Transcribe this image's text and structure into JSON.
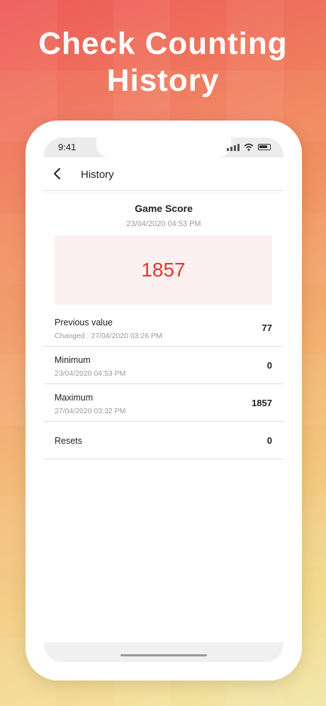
{
  "headline": {
    "line1": "Check Counting",
    "line2": "History"
  },
  "status_bar": {
    "time": "9:41",
    "icons": [
      "signal-icon",
      "wifi-icon",
      "battery-icon"
    ]
  },
  "app_bar": {
    "title": "History",
    "back_icon": "chevron-left-icon"
  },
  "counter": {
    "name": "Game Score",
    "date": "23/04/2020 04:53 PM",
    "value": "1857",
    "value_color": "#e8342f",
    "box_color": "#fdf0f0"
  },
  "stats": [
    {
      "label": "Previous value",
      "sub": "Changed : 27/04/2020 03:26 PM",
      "value": "77"
    },
    {
      "label": "Minimum",
      "sub": "23/04/2020 04:53 PM",
      "value": "0"
    },
    {
      "label": "Maximum",
      "sub": "27/04/2020 03:32 PM",
      "value": "1857"
    },
    {
      "label": "Resets",
      "sub": "",
      "value": "0"
    }
  ]
}
